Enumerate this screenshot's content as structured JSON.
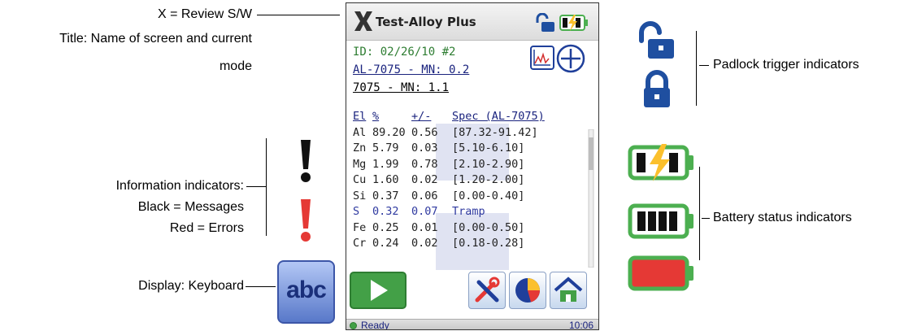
{
  "annotations": {
    "review": "X = Review S/W",
    "title_line1": "Title: Name of screen and current",
    "title_line2": "mode",
    "info_line1": "Information indicators:",
    "info_line2": "Black = Messages",
    "info_line3": "Red = Errors",
    "keyboard": "Display: Keyboard",
    "padlock": "Padlock trigger indicators",
    "battery": "Battery status indicators"
  },
  "device": {
    "title": "Test-Alloy Plus",
    "id_line": "ID:  02/26/10 #2",
    "match1": "AL-7075 - MN: 0.2",
    "match2": "7075 - MN: 1.1",
    "headers": {
      "el": "El",
      "pct": "%",
      "err": "+/-",
      "spec": "Spec (AL-7075)"
    },
    "rows": [
      {
        "el": "Al",
        "pct": "89.20",
        "err": "0.56",
        "spec": "[87.32-91.42]"
      },
      {
        "el": "Zn",
        "pct": "5.79",
        "err": "0.03",
        "spec": "[5.10-6.10]"
      },
      {
        "el": "Mg",
        "pct": "1.99",
        "err": "0.78",
        "spec": "[2.10-2.90]"
      },
      {
        "el": "Cu",
        "pct": "1.60",
        "err": "0.02",
        "spec": "[1.20-2.00]"
      },
      {
        "el": "Si",
        "pct": "0.37",
        "err": "0.06",
        "spec": "[0.00-0.40]"
      },
      {
        "el": "S",
        "pct": "0.32",
        "err": "0.07",
        "spec": "Tramp"
      },
      {
        "el": "Fe",
        "pct": "0.25",
        "err": "0.01",
        "spec": "[0.00-0.50]"
      },
      {
        "el": "Cr",
        "pct": "0.24",
        "err": "0.02",
        "spec": "[0.18-0.28]"
      }
    ],
    "status": "Ready",
    "time": "10:06"
  },
  "keyboard_icon_text": "abc",
  "icons": {
    "title": "x-review-icon",
    "padlock_open": "padlock-open-icon",
    "padlock_closed": "padlock-closed-icon",
    "info_black": "exclamation-black-icon",
    "info_red": "exclamation-red-icon",
    "battery_charging": "battery-charging-icon",
    "battery_full": "battery-full-icon",
    "battery_empty": "battery-empty-icon",
    "graph": "graph-icon",
    "zoom": "zoom-plus-icon",
    "start": "play-icon",
    "tools": "tools-icon",
    "pie": "pie-chart-icon",
    "home": "home-icon"
  },
  "colors": {
    "accent_blue": "#1a237e",
    "id_green": "#2e7d32",
    "play_green": "#43a047",
    "error_red": "#e53935",
    "battery_green": "#4caf50"
  }
}
